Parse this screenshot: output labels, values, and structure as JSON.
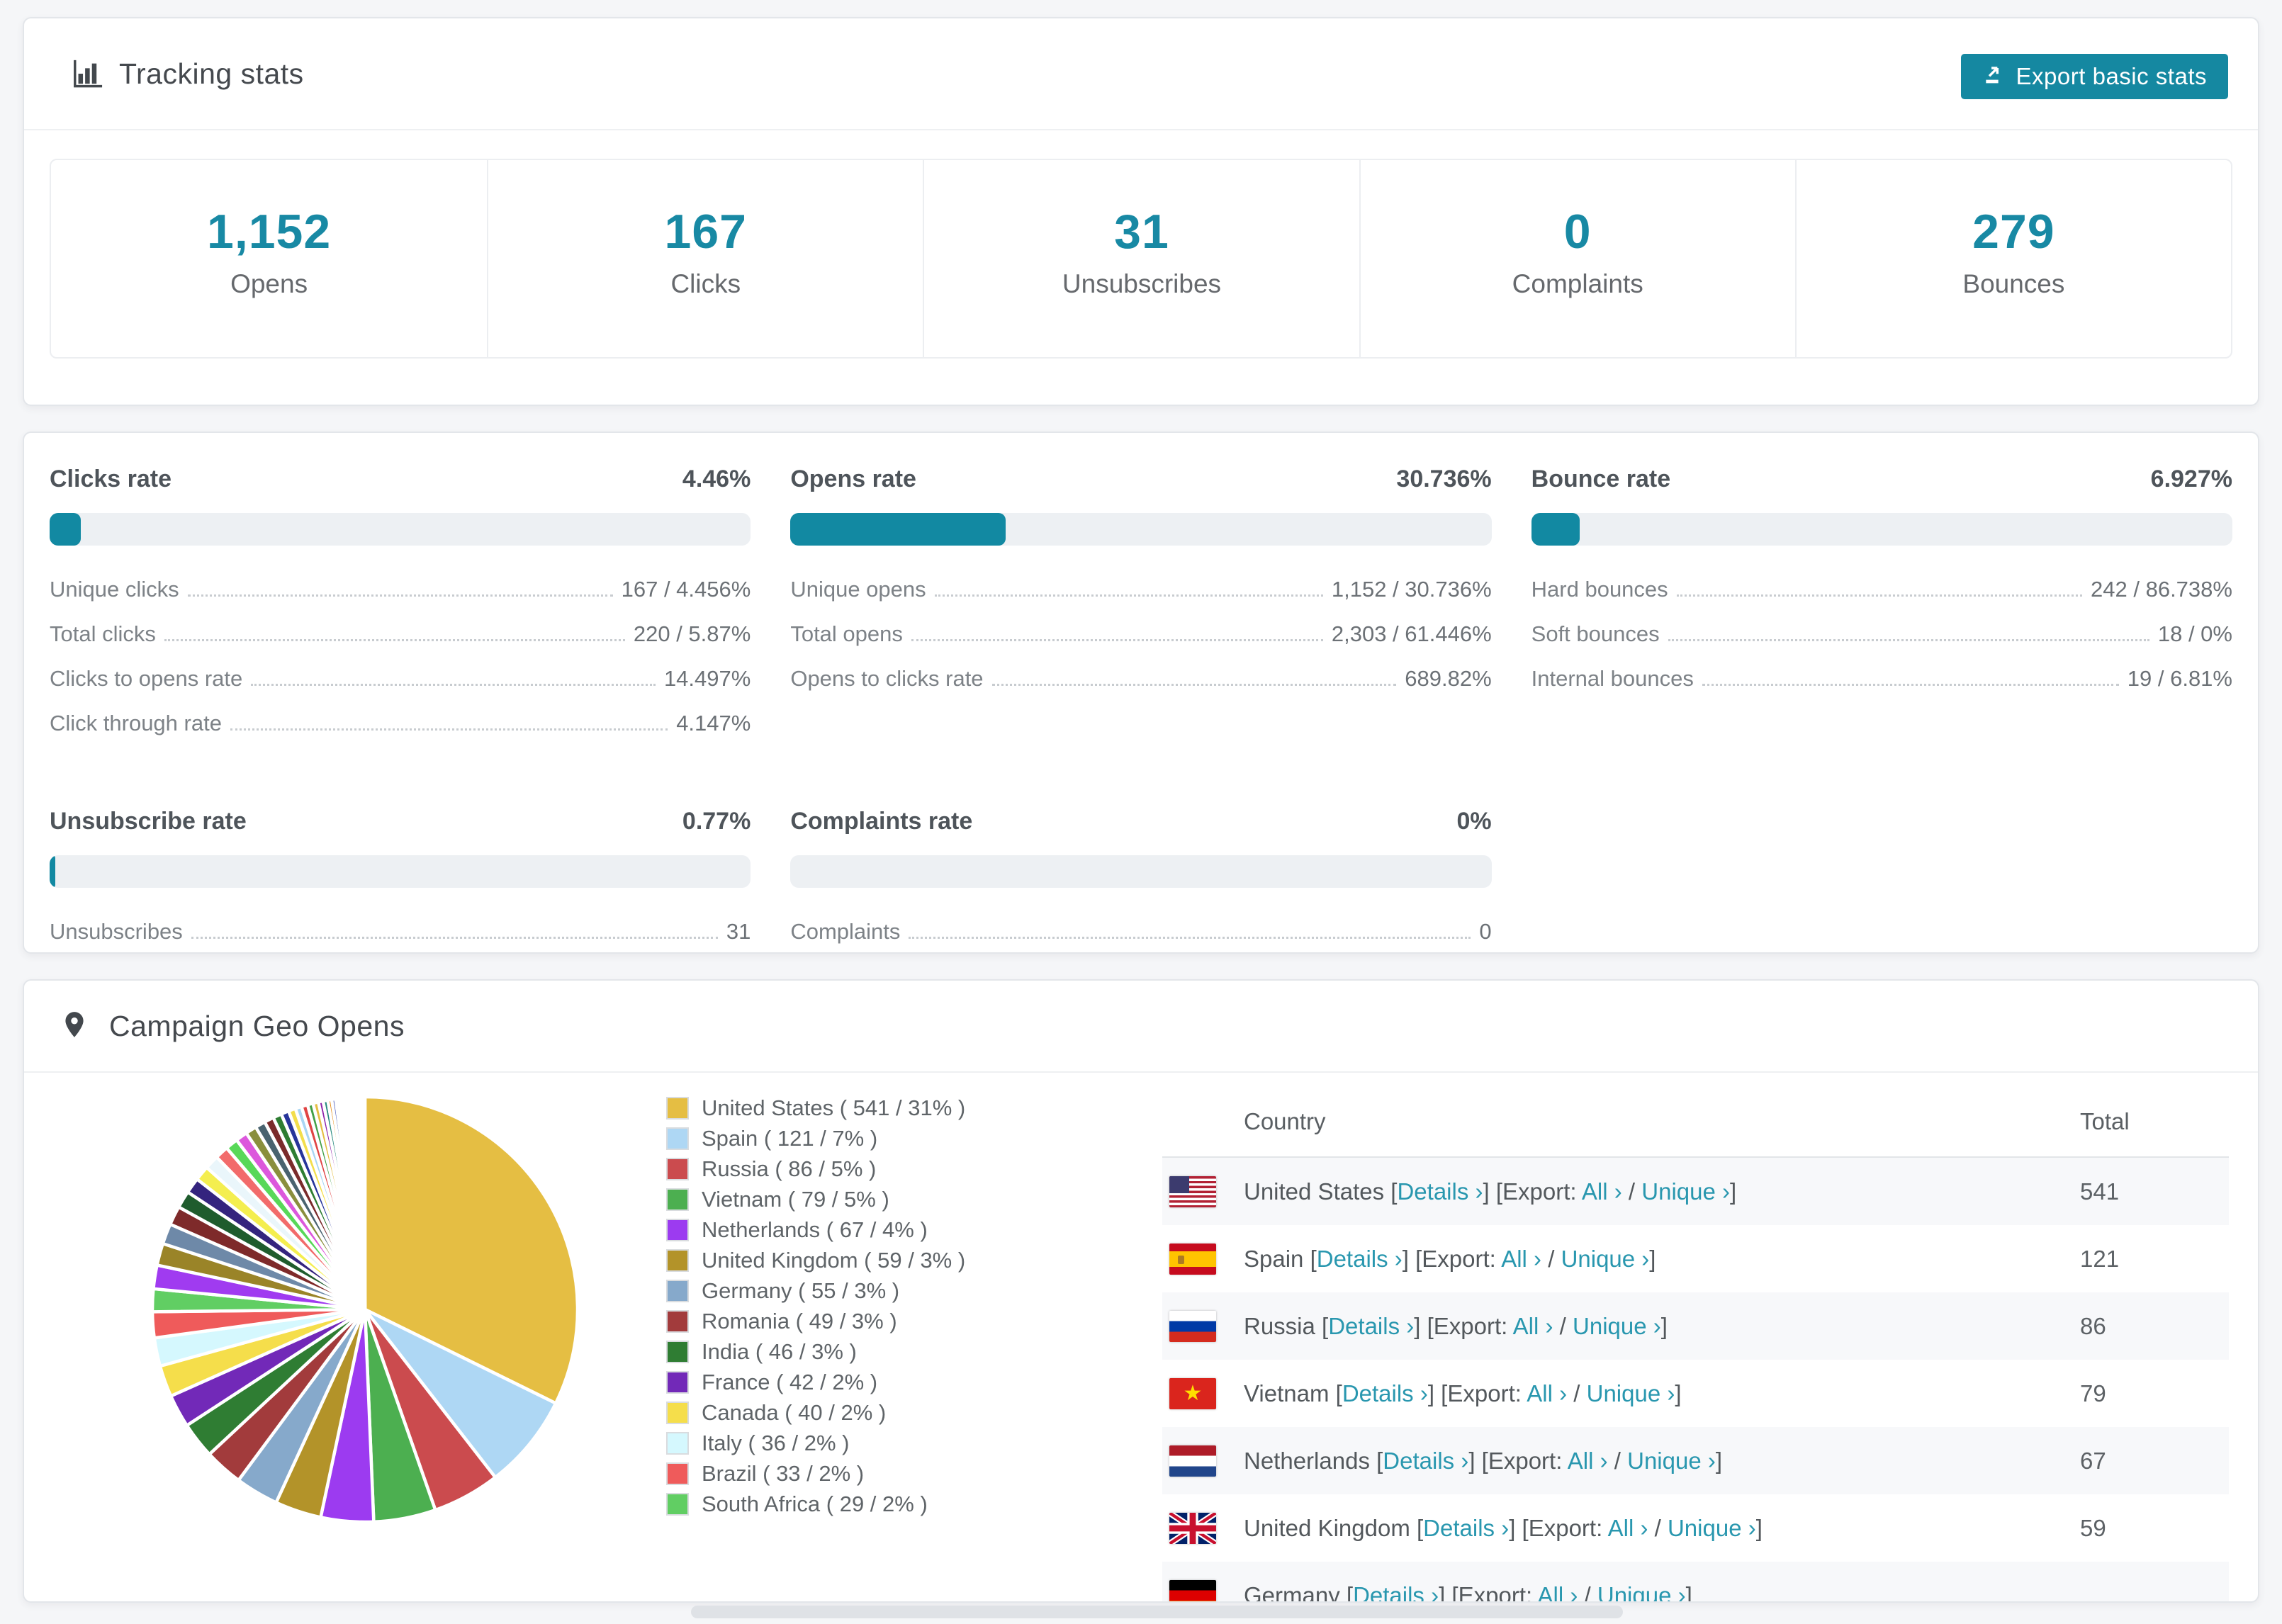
{
  "accent": "#1589a2",
  "tracking": {
    "title": "Tracking stats",
    "export_button": "Export basic stats",
    "stats": [
      {
        "value": "1,152",
        "label": "Opens"
      },
      {
        "value": "167",
        "label": "Clicks"
      },
      {
        "value": "31",
        "label": "Unsubscribes"
      },
      {
        "value": "0",
        "label": "Complaints"
      },
      {
        "value": "279",
        "label": "Bounces"
      }
    ]
  },
  "rates": {
    "groups": [
      {
        "title": "Clicks rate",
        "value": "4.46%",
        "percent": 4.46,
        "rows": [
          {
            "label": "Unique clicks",
            "value": "167 / 4.456%"
          },
          {
            "label": "Total clicks",
            "value": "220 / 5.87%"
          },
          {
            "label": "Clicks to opens rate",
            "value": "14.497%"
          },
          {
            "label": "Click through rate",
            "value": "4.147%"
          }
        ]
      },
      {
        "title": "Opens rate",
        "value": "30.736%",
        "percent": 30.736,
        "rows": [
          {
            "label": "Unique opens",
            "value": "1,152 / 30.736%"
          },
          {
            "label": "Total opens",
            "value": "2,303 / 61.446%"
          },
          {
            "label": "Opens to clicks rate",
            "value": "689.82%"
          }
        ]
      },
      {
        "title": "Bounce rate",
        "value": "6.927%",
        "percent": 6.927,
        "rows": [
          {
            "label": "Hard bounces",
            "value": "242 / 86.738%"
          },
          {
            "label": "Soft bounces",
            "value": "18 / 0%"
          },
          {
            "label": "Internal bounces",
            "value": "19 / 6.81%"
          }
        ]
      },
      {
        "title": "Unsubscribe rate",
        "value": "0.77%",
        "percent": 0.77,
        "rows": [
          {
            "label": "Unsubscribes",
            "value": "31"
          }
        ]
      },
      {
        "title": "Complaints rate",
        "value": "0%",
        "percent": 0,
        "rows": [
          {
            "label": "Complaints",
            "value": "0"
          }
        ]
      }
    ]
  },
  "geo": {
    "title": "Campaign Geo Opens",
    "table": {
      "header_country": "Country",
      "header_total": "Total",
      "details_label": "Details ›",
      "export_label": "Export:",
      "all_label": "All ›",
      "unique_label": "Unique ›",
      "rows": [
        {
          "country": "United States",
          "total": "541",
          "flag": "us"
        },
        {
          "country": "Spain",
          "total": "121",
          "flag": "es"
        },
        {
          "country": "Russia",
          "total": "86",
          "flag": "ru"
        },
        {
          "country": "Vietnam",
          "total": "79",
          "flag": "vn"
        },
        {
          "country": "Netherlands",
          "total": "67",
          "flag": "nl"
        },
        {
          "country": "United Kingdom",
          "total": "59",
          "flag": "gb"
        },
        {
          "country": "Germany",
          "total": "",
          "flag": "de"
        }
      ]
    }
  },
  "chart_data": {
    "type": "pie",
    "title": "Campaign Geo Opens",
    "legend_position": "right-of-pie",
    "start_angle_deg": -90,
    "direction": "clockwise",
    "series": [
      {
        "name": "United States",
        "value": 541,
        "pct": "31%",
        "color": "#e5be43",
        "legend": "United States ( 541 / 31% )"
      },
      {
        "name": "Spain",
        "value": 121,
        "pct": "7%",
        "color": "#aed7f4",
        "legend": "Spain ( 121 / 7% )"
      },
      {
        "name": "Russia",
        "value": 86,
        "pct": "5%",
        "color": "#cb4b4e",
        "legend": "Russia ( 86 / 5% )"
      },
      {
        "name": "Vietnam",
        "value": 79,
        "pct": "5%",
        "color": "#4caf50",
        "legend": "Vietnam ( 79 / 5% )"
      },
      {
        "name": "Netherlands",
        "value": 67,
        "pct": "4%",
        "color": "#9c3bf0",
        "legend": "Netherlands ( 67 / 4% )"
      },
      {
        "name": "United Kingdom",
        "value": 59,
        "pct": "3%",
        "color": "#b39329",
        "legend": "United Kingdom ( 59 / 3% )"
      },
      {
        "name": "Germany",
        "value": 55,
        "pct": "3%",
        "color": "#86a9cb",
        "legend": "Germany ( 55 / 3% )"
      },
      {
        "name": "Romania",
        "value": 49,
        "pct": "3%",
        "color": "#a23b3c",
        "legend": "Romania ( 49 / 3% )"
      },
      {
        "name": "India",
        "value": 46,
        "pct": "3%",
        "color": "#2f7d33",
        "legend": "India ( 46 / 3% )"
      },
      {
        "name": "France",
        "value": 42,
        "pct": "2%",
        "color": "#7229b8",
        "legend": "France ( 42 / 2% )"
      },
      {
        "name": "Canada",
        "value": 40,
        "pct": "2%",
        "color": "#f5de4b",
        "legend": "Canada ( 40 / 2% )"
      },
      {
        "name": "Italy",
        "value": 36,
        "pct": "2%",
        "color": "#d5f8fe",
        "legend": "Italy ( 36 / 2% )"
      },
      {
        "name": "Brazil",
        "value": 33,
        "pct": "2%",
        "color": "#ef5b5b",
        "legend": "Brazil ( 33 / 2% )"
      },
      {
        "name": "South Africa",
        "value": 29,
        "pct": "2%",
        "color": "#61ce63",
        "legend": "South Africa ( 29 / 2% )"
      }
    ],
    "unlabeled_slices": {
      "values": [
        30,
        28,
        26,
        24,
        22,
        20,
        19,
        18,
        17,
        16,
        15,
        14,
        13,
        12,
        11,
        10,
        9,
        8,
        8,
        7,
        7,
        6,
        6,
        5,
        5,
        4,
        4,
        4,
        3,
        3,
        3,
        2,
        2,
        2,
        2,
        2,
        1,
        1,
        1,
        1,
        1,
        1
      ],
      "colors": [
        "#a03bf0",
        "#9a8428",
        "#6e89a8",
        "#7e2a2a",
        "#1f5c2d",
        "#34247e",
        "#f4ee4f",
        "#eaf6fb",
        "#f26b6b",
        "#58d858",
        "#dc58dc",
        "#8a8f3d",
        "#49636f",
        "#7a2b2b",
        "#2e7d32",
        "#27359a",
        "#f3de4c",
        "#a9d6f3",
        "#e04444",
        "#43a047",
        "#e5be43",
        "#8e24aa",
        "#26897e",
        "#e5890f",
        "#5c6bc0",
        "#d81b60",
        "#7cb342",
        "#00acc1",
        "#f06292",
        "#9575cd",
        "#4db6ac",
        "#ffb74d",
        "#a1887f",
        "#90a4ae",
        "#c0ca33",
        "#26a69a",
        "#ec407a",
        "#7e57c2",
        "#66bb6a",
        "#ffa726",
        "#29b6f6",
        "#ef5350"
      ]
    }
  }
}
